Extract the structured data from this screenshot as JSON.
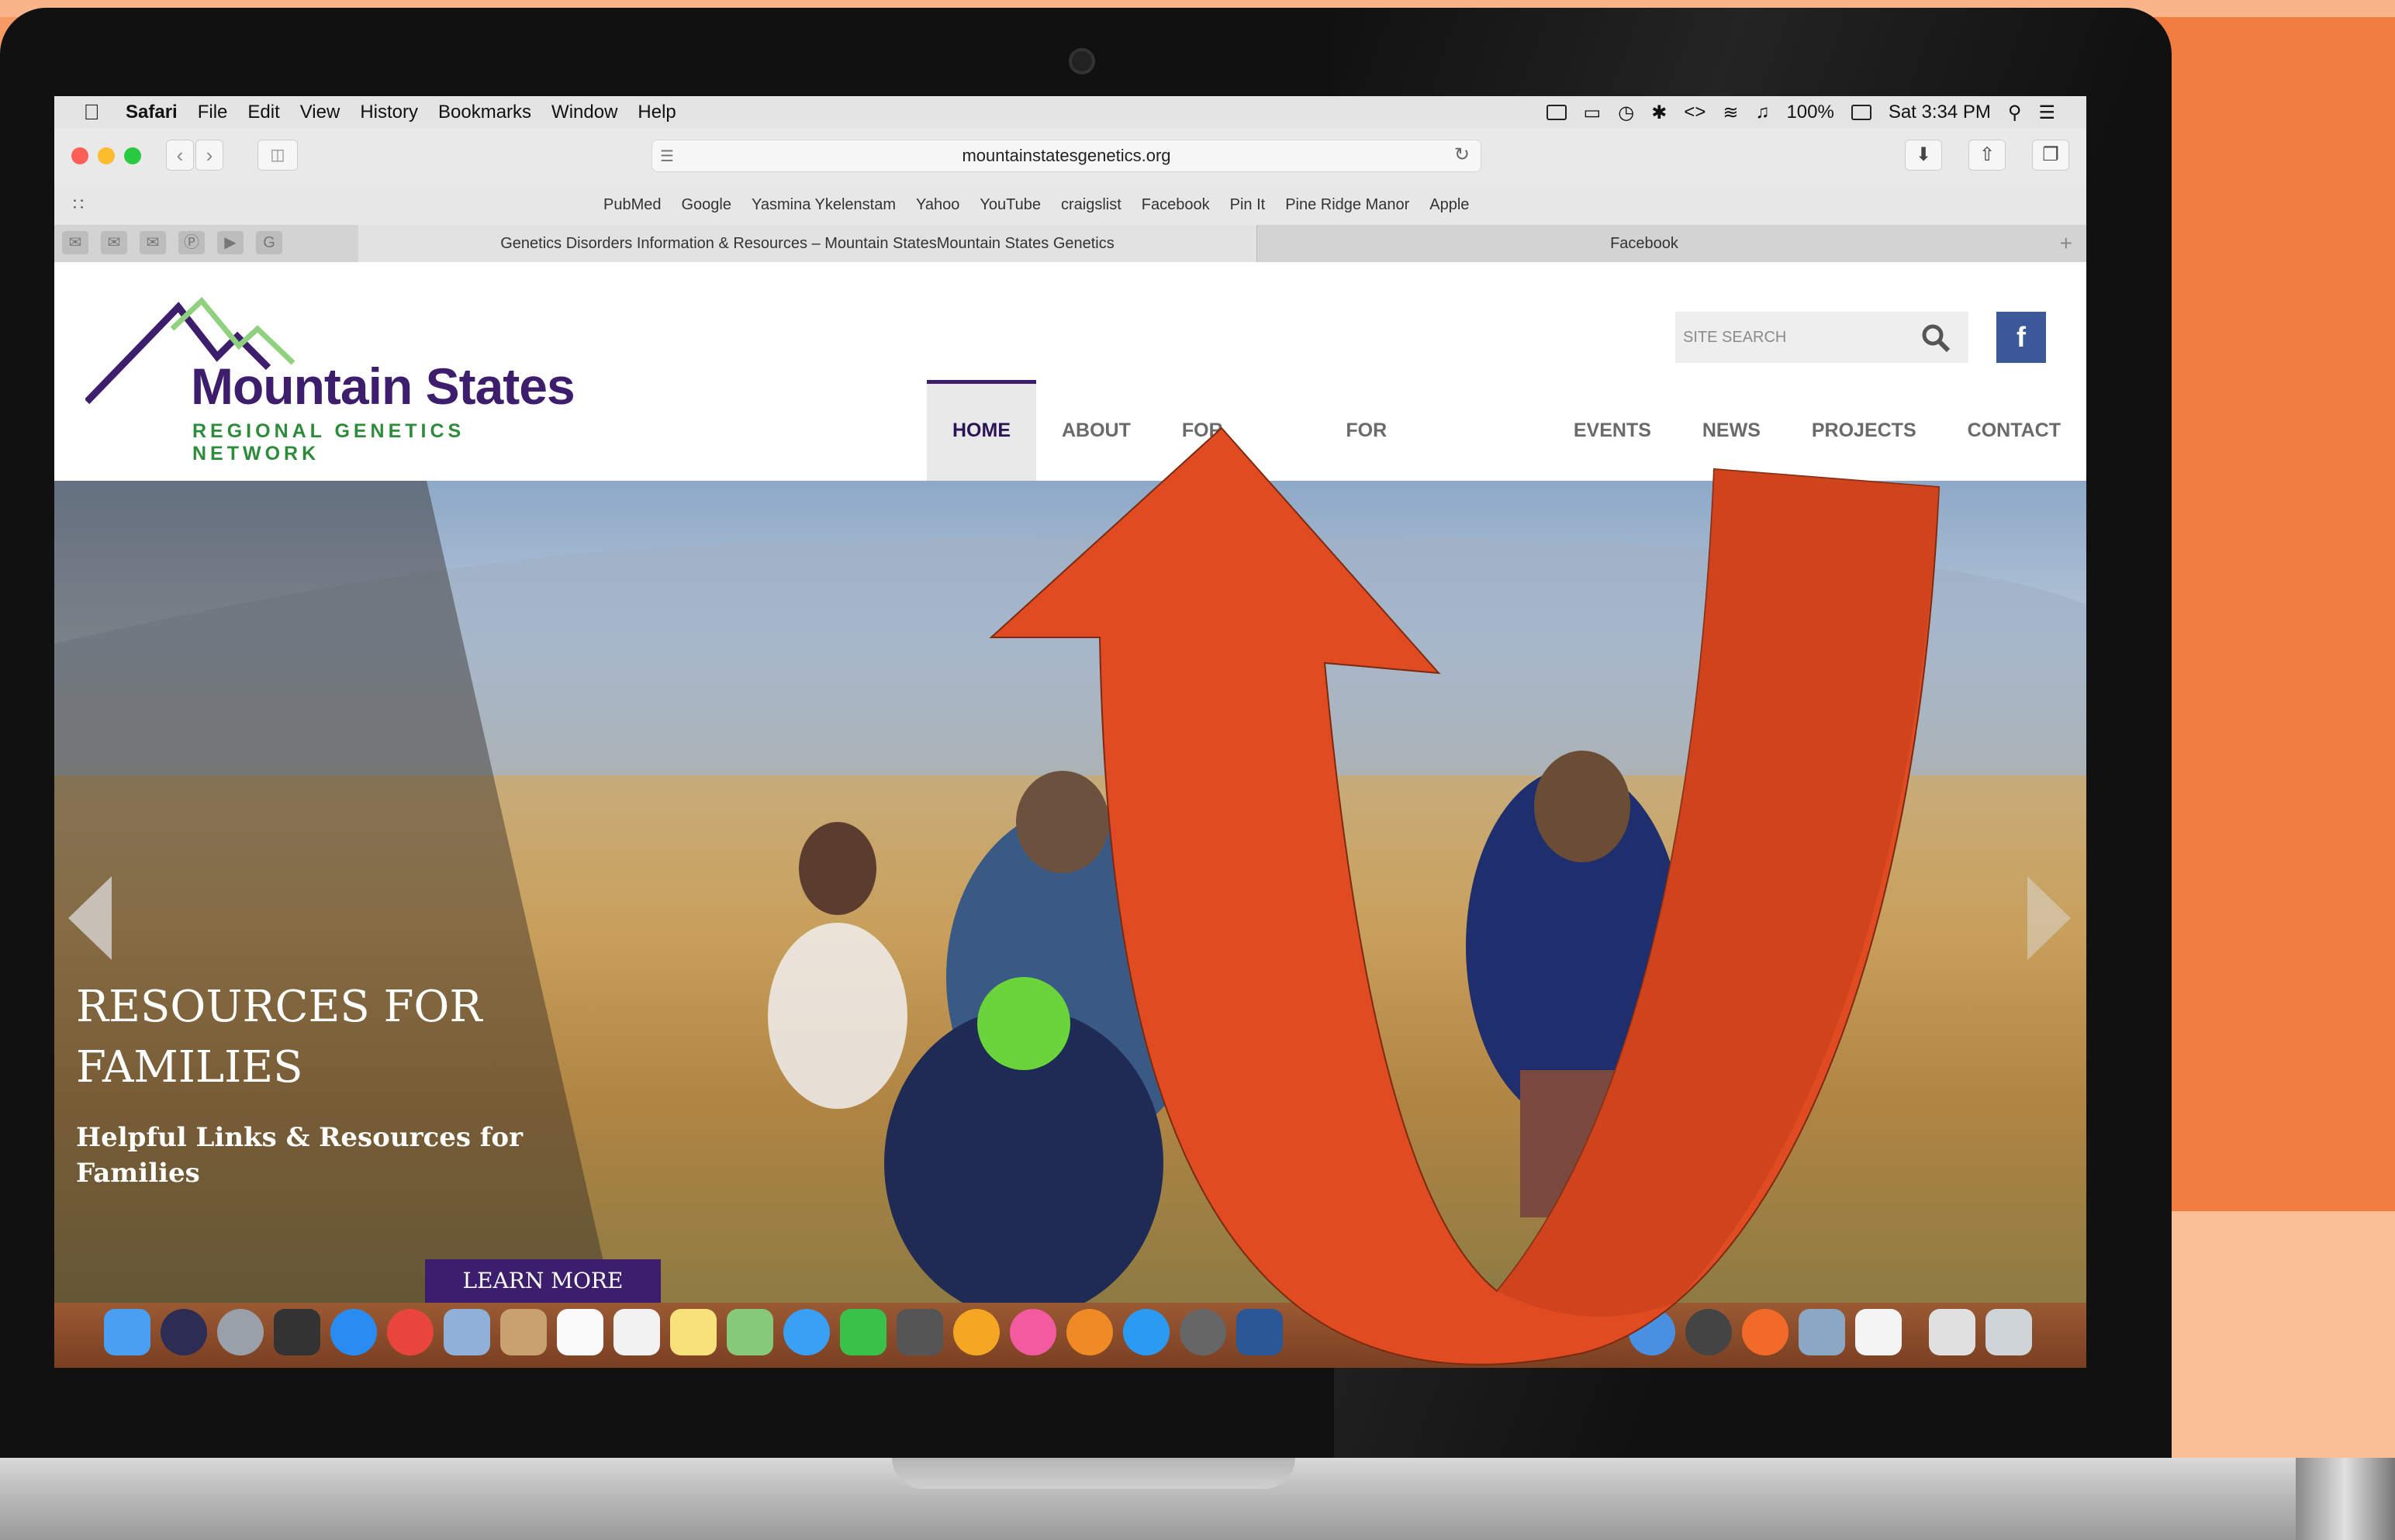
{
  "menubar": {
    "app": "Safari",
    "items": [
      "File",
      "Edit",
      "View",
      "History",
      "Bookmarks",
      "Window",
      "Help"
    ],
    "battery": "100%",
    "clock": "Sat 3:34 PM"
  },
  "browser": {
    "url": "mountainstatesgenetics.org",
    "bookmarks": [
      "PubMed",
      "Google",
      "Yasmina Ykelenstam",
      "Yahoo",
      "YouTube",
      "craigslist",
      "Facebook",
      "Pin It",
      "Pine Ridge Manor",
      "Apple"
    ],
    "tabs": [
      {
        "title": "Genetics Disorders Information & Resources – Mountain StatesMountain States Genetics",
        "active": true
      },
      {
        "title": "Facebook",
        "active": false
      }
    ]
  },
  "site": {
    "logo_main": "Mountain States",
    "logo_sub": "REGIONAL GENETICS NETWORK",
    "search_placeholder": "SITE SEARCH",
    "facebook_glyph": "f",
    "nav": [
      "HOME",
      "ABOUT",
      "FOR FAMILIES",
      "FOR PROFESSIONALS",
      "EVENTS",
      "NEWS",
      "PROJECTS",
      "CONTACT"
    ],
    "active_nav": "HOME",
    "hero": {
      "title": "RESOURCES FOR FAMILIES",
      "subtitle": "Helpful Links & Resources for Families",
      "button": "LEARN MORE"
    }
  },
  "colors": {
    "brand_purple": "#3d1e6d",
    "brand_green": "#2e8b3b",
    "facebook_blue": "#3b5998",
    "annotation_arrow": "#e04b22",
    "background_orange": "#f79a66"
  },
  "icons": [
    "apple-icon",
    "search-icon",
    "facebook-icon",
    "back-icon",
    "forward-icon",
    "sidebar-icon",
    "reload-icon",
    "download-icon",
    "share-icon",
    "tabs-icon",
    "lock-icon"
  ]
}
